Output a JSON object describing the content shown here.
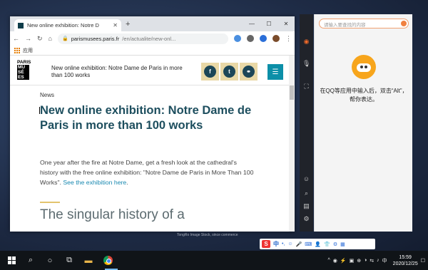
{
  "browser": {
    "tab_title": "New online exhibition: Notre D",
    "tab_close": "✕",
    "new_tab": "+",
    "window_controls": [
      "—",
      "☐",
      "✕"
    ],
    "url_domain": "parismusees.paris.fr",
    "url_path": "/en/actualite/new-onl...",
    "bookmarks_apps": "应用",
    "nav": {
      "back": "←",
      "forward": "→",
      "reload": "↻",
      "home": "⌂"
    }
  },
  "site": {
    "logo_lines": [
      "PARIS",
      "MU",
      "SÉ",
      "ES"
    ],
    "header_title": "New online exhibition: Notre Dame de Paris in more than 100 works",
    "social": [
      "f",
      "t",
      "⚭"
    ],
    "menu_icon": "☰"
  },
  "article": {
    "kicker": "News",
    "title": "New online exhibition: Notre Dame de Paris in more than 100 works",
    "lede": "One year after the fire at Notre Dame, get a fresh look at the cathedral's history with the free online exhibition: \"Notre Dame de Paris in More Than 100 Works\".",
    "lede_link": "See the exhibition here",
    "lede_end": ".",
    "subheading": "The singular history of a"
  },
  "qq": {
    "search_placeholder": "请输入要查找的内容",
    "tip": "在QQ等应用中输入后，双击“Alt”，帮你表达。"
  },
  "ime": {
    "logo": "S",
    "mode": "中",
    "items": [
      "•,",
      "☺",
      "🎤",
      "⌨",
      "👤",
      "👕",
      "⚙",
      "▦"
    ]
  },
  "watermark": "TongRo Image Stock, since commerce",
  "taskbar": {
    "search_icon": "⌕",
    "clock_time": "15:59",
    "clock_date": "2020/12/25",
    "tray_icons": [
      "^",
      "◉",
      "⚡",
      "▣",
      "⊕",
      "◑",
      "⇆",
      "♪",
      "中",
      "☐"
    ]
  },
  "colors": {
    "accent_teal": "#1d4e5e",
    "link": "#1888b0",
    "gold": "#e9d8a6",
    "menu_button": "#0c8fa8"
  }
}
